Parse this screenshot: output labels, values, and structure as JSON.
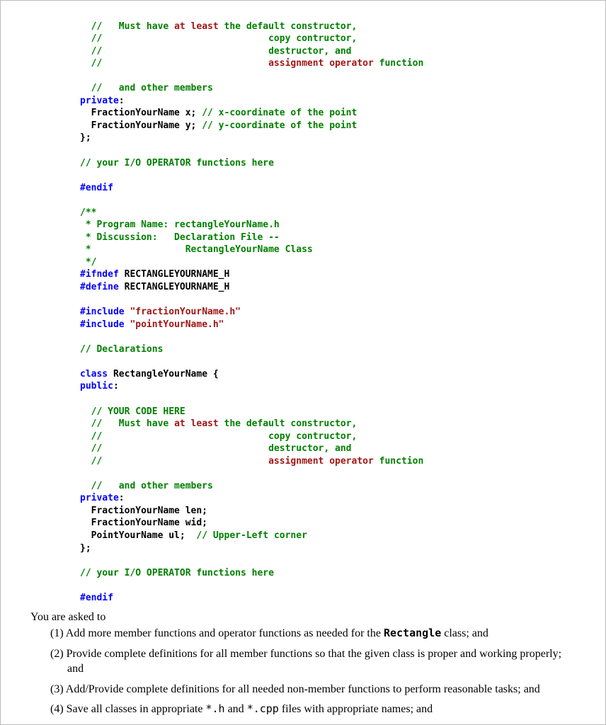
{
  "code": {
    "block1": {
      "l1_a": "//   Must have ",
      "l1_b": "at least",
      "l1_c": " the default constructor,",
      "l2": "//                              copy contructor,",
      "l3": "//                              destructor, and",
      "l4_a": "//                              ",
      "l4_b": "assignment operator",
      "l4_c": " function",
      "blank1": "",
      "l5": "  //   and other members",
      "l6_kw": "private",
      "l6_colon": ":",
      "l7_a": "  FractionYourName x; ",
      "l7_b": "// x-coordinate of the point",
      "l8_a": "  FractionYourName y; ",
      "l8_b": "// y-coordinate of the point",
      "l9": "};"
    },
    "io1": "// your I/O OPERATOR functions here",
    "endif1": "#endif",
    "header2": {
      "l1": "/**",
      "l2": " * Program Name: rectangleYourName.h",
      "l3": " * Discussion:   Declaration File --",
      "l4": " *                 RectangleYourName Class",
      "l5": " */",
      "ifndef_kw": "#ifndef",
      "ifndef_v": " RECTANGLEYOURNAME_H",
      "define_kw": "#define",
      "define_v": " RECTANGLEYOURNAME_H"
    },
    "includes": {
      "kw": "#include",
      "inc1": " \"fractionYourName.h\"",
      "inc2": " \"pointYourName.h\""
    },
    "decl": "// Declarations",
    "classline": {
      "kw": "class",
      "name": " RectangleYourName {"
    },
    "public_kw": "public",
    "public_colon": ":",
    "block2": {
      "l0": "// YOUR CODE HERE",
      "l1_a": "//   Must have ",
      "l1_b": "at least",
      "l1_c": " the default constructor,",
      "l2": "//                              copy contructor,",
      "l3": "//                              destructor, and",
      "l4_a": "//                              ",
      "l4_b": "assignment operator",
      "l4_c": " function",
      "blank1": "",
      "l5": "  //   and other members"
    },
    "private2_kw": "private",
    "private2_colon": ":",
    "members2": {
      "l1": "  FractionYourName len;",
      "l2": "  FractionYourName wid;",
      "l3_a": "  PointYourName ul;  ",
      "l3_b": "// Upper-Left corner"
    },
    "close2": "};",
    "io2": "// your I/O OPERATOR functions here",
    "endif2": "#endif"
  },
  "instr": {
    "lead": "You are asked to",
    "i1_a": "(1) Add more member functions and operator functions as needed for the ",
    "i1_b": "Rectangle",
    "i1_c": " class; and",
    "i2": "(2) Provide complete definitions for all member functions so that the given class is proper and working properly; and",
    "i3": "(3) Add/Provide complete definitions for all needed non-member functions to perform reasonable tasks; and",
    "i4_a": "(4) Save all classes in appropriate ",
    "i4_b": "*.h",
    "i4_c": " and ",
    "i4_d": "*.cpp",
    "i4_e": " files with appropriate  names; and"
  }
}
